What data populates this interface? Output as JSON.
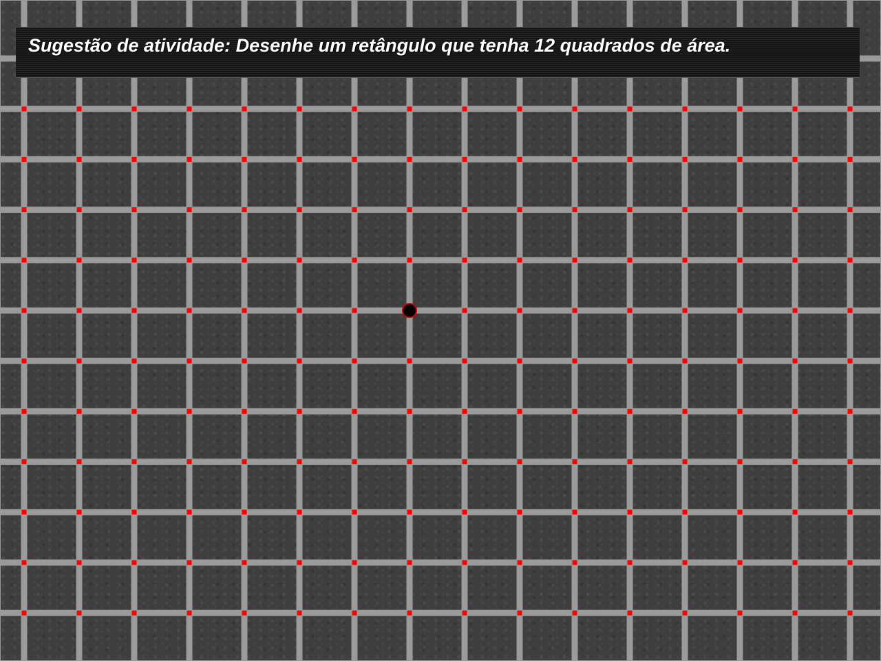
{
  "activity": {
    "prompt": "Sugestão de atividade: Desenhe um retângulo que tenha 12 quadrados de área."
  },
  "board": {
    "columns": 16,
    "rows": 12,
    "grid_line_color": "#9b9b9b",
    "intersection_dot_color": "#ff0000",
    "background_color": "#3e3e3e",
    "cursor": {
      "column": 7,
      "row": 5,
      "color": "#000000",
      "outline_color": "#cc0000"
    }
  }
}
